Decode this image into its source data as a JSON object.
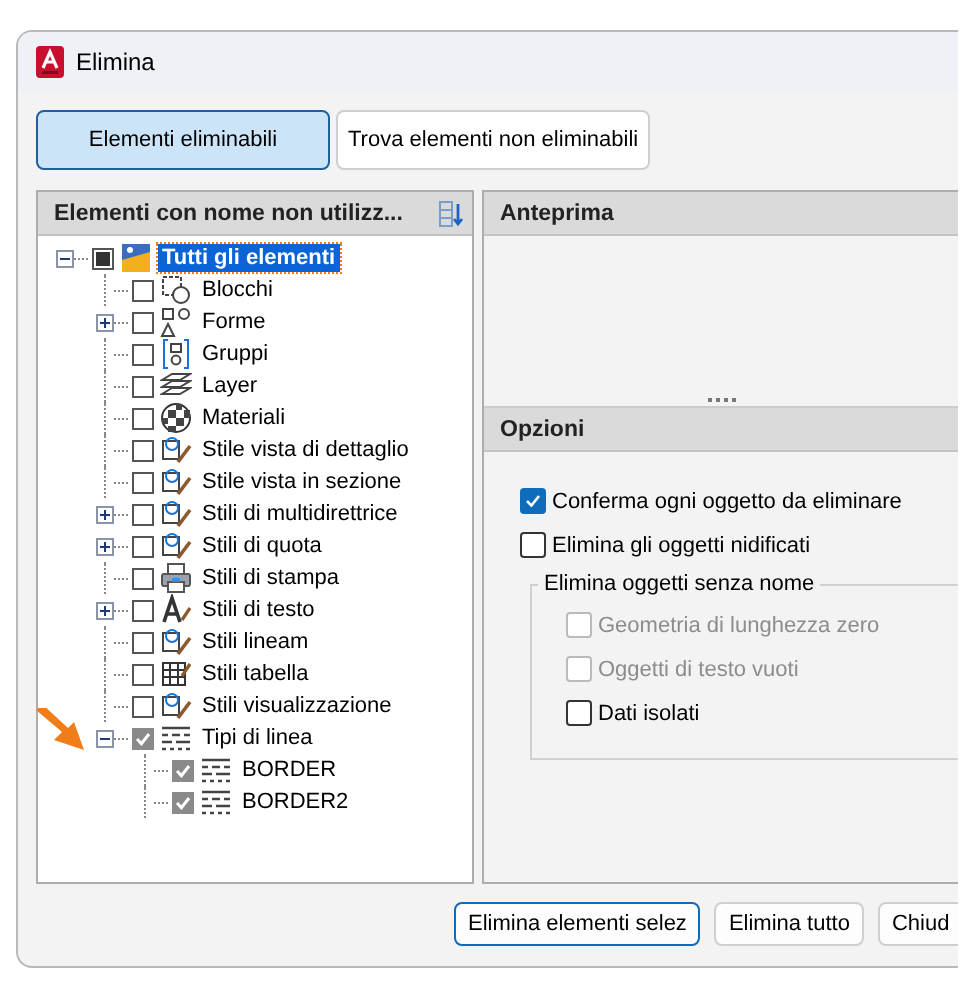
{
  "window": {
    "title": "Elimina"
  },
  "tabs": [
    {
      "label": "Elementi eliminabili",
      "selected": true
    },
    {
      "label": "Trova elementi non eliminabili",
      "selected": false
    }
  ],
  "tree": {
    "header": "Elementi con nome non utilizz...",
    "items": [
      {
        "label": "Tutti gli elementi",
        "checked": false,
        "partial": true,
        "selected": true,
        "expanded": true,
        "children": [
          {
            "label": "Blocchi",
            "checked": false,
            "selected": false
          },
          {
            "label": "Forme",
            "checked": false,
            "selected": false,
            "expanded": false
          },
          {
            "label": "Gruppi",
            "checked": false,
            "selected": false
          },
          {
            "label": "Layer",
            "checked": false,
            "selected": false
          },
          {
            "label": "Materiali",
            "checked": false,
            "selected": false
          },
          {
            "label": "Stile vista di dettaglio",
            "checked": false,
            "selected": false
          },
          {
            "label": "Stile vista in sezione",
            "checked": false,
            "selected": false
          },
          {
            "label": "Stili di multidirettrice",
            "checked": false,
            "selected": false,
            "expanded": false
          },
          {
            "label": "Stili di quota",
            "checked": false,
            "selected": false,
            "expanded": false
          },
          {
            "label": "Stili di stampa",
            "checked": false,
            "selected": false
          },
          {
            "label": "Stili di testo",
            "checked": false,
            "selected": false,
            "expanded": false
          },
          {
            "label": "Stili lineam",
            "checked": false,
            "selected": false
          },
          {
            "label": "Stili tabella",
            "checked": false,
            "selected": false
          },
          {
            "label": "Stili visualizzazione",
            "checked": false,
            "selected": false
          },
          {
            "label": "Tipi di linea",
            "checked": true,
            "selected": false,
            "expanded": true,
            "children": [
              {
                "label": "BORDER",
                "checked": true,
                "selected": false
              },
              {
                "label": "BORDER2",
                "checked": true,
                "selected": false
              }
            ]
          }
        ]
      }
    ]
  },
  "preview": {
    "header": "Anteprima"
  },
  "options": {
    "header": "Opzioni",
    "items": [
      {
        "label": "Conferma ogni oggetto da eliminare",
        "checked": true,
        "disabled": false
      },
      {
        "label": "Elimina gli oggetti nidificati",
        "checked": false,
        "disabled": false
      }
    ],
    "group": {
      "title": "Elimina oggetti senza nome",
      "items": [
        {
          "label": "Geometria di lunghezza zero",
          "checked": false,
          "disabled": true
        },
        {
          "label": "Oggetti di testo vuoti",
          "checked": false,
          "disabled": true
        },
        {
          "label": "Dati isolati",
          "checked": false,
          "disabled": false
        }
      ]
    }
  },
  "buttons": [
    {
      "label": "Elimina elementi selez",
      "default": true
    },
    {
      "label": "Elimina tutto",
      "default": false
    },
    {
      "label": "Chiud",
      "default": false
    }
  ]
}
